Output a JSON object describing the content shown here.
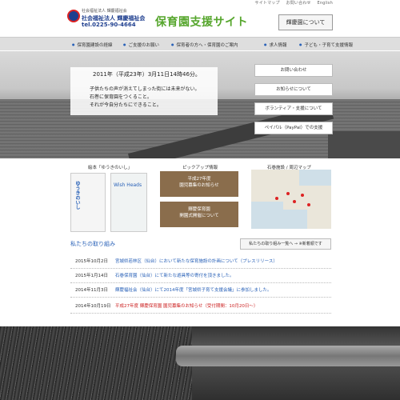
{
  "header": {
    "top_links": [
      "サイトマップ",
      "お問い合わせ",
      "English"
    ],
    "org_line1": "社会福祉法人 輝慶福祉会",
    "org_name": "社会福祉法人 輝慶福祉会",
    "phone": "tel.0225-90-4664",
    "site_title": "保育園支援サイト",
    "about_label": "輝慶園について"
  },
  "nav": {
    "items": [
      "保育園建設の経緯",
      "ご支援のお願い",
      "保育者の方へ・保育園のご案内",
      "求人情報",
      "子ども・子育て支援情報"
    ]
  },
  "hero": {
    "date_line": "2011年（平成23年）3月11日14時46分。",
    "lines": [
      "子供たちの声が消えてしまった街には未来がない。",
      "石巻に保育園をつくること。",
      "それが今自分たちにできること。"
    ],
    "buttons": [
      "お問い合わせ",
      "お知らせについて",
      "ボランティア・支援について",
      "ペイパル（PayPal）での支援"
    ]
  },
  "sections": {
    "book_title": "絵本「ゆうきのいし」",
    "book1_title": "ゆうきのいし",
    "book2_title": "Wish Heads",
    "pickup_title": "ピックアップ情報",
    "pickup1": "平成27年度\n園児募集のお知らせ",
    "pickup2": "輝慶保育園\n開園式開催について",
    "map_title": "石巻施設 / 周辺マップ"
  },
  "efforts": {
    "title": "私たちの取り組み",
    "button_label": "私たちの取り組み一覧へ → ※新着順です",
    "news": [
      {
        "date": "2015年10月2日",
        "text": "宮城県若林区（仙台）において新たな保育施設の計画について（プレスリリース）",
        "red": false
      },
      {
        "date": "2015年1月14日",
        "text": "石巻保育園（仙台）にて新たな遊具等の寄付を頂きました。",
        "red": false
      },
      {
        "date": "2014年11月3日",
        "text": "輝慶福祉会（仙台）にて2014年度「宮城県子育て支援会議」に参加しました。",
        "red": false
      },
      {
        "date": "2014年10月19日",
        "text": "平成27年度 輝慶保育園 園児募集のお知らせ（受付期間：10月20日〜）",
        "red": true
      }
    ]
  },
  "colors": {
    "accent_green": "#56a62d",
    "accent_blue": "#2a62b8",
    "nav_bg": "#dedede"
  }
}
